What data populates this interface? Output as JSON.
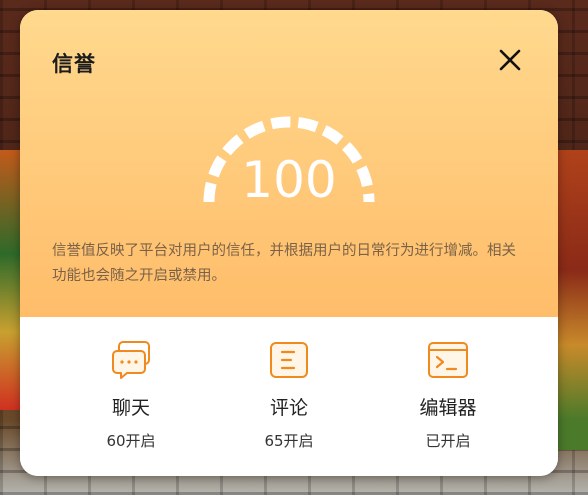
{
  "dialog": {
    "title": "信誉",
    "score": "100",
    "score_fraction": 1.0,
    "description": "信誉值反映了平台对用户的信任，并根据用户的日常行为进行增减。相关功能也会随之开启或禁用。",
    "close_icon": "close-icon"
  },
  "features": [
    {
      "icon": "chat-bubbles-icon",
      "name": "聊天",
      "status": "60开启"
    },
    {
      "icon": "comment-list-icon",
      "name": "评论",
      "status": "65开启"
    },
    {
      "icon": "code-editor-icon",
      "name": "编辑器",
      "status": "已开启"
    }
  ],
  "colors": {
    "accent": "#f08a1e",
    "header_top": "#ffd98e",
    "header_bottom": "#ffbd6a",
    "description_text": "#7a6248",
    "score_text": "#ffffff"
  }
}
